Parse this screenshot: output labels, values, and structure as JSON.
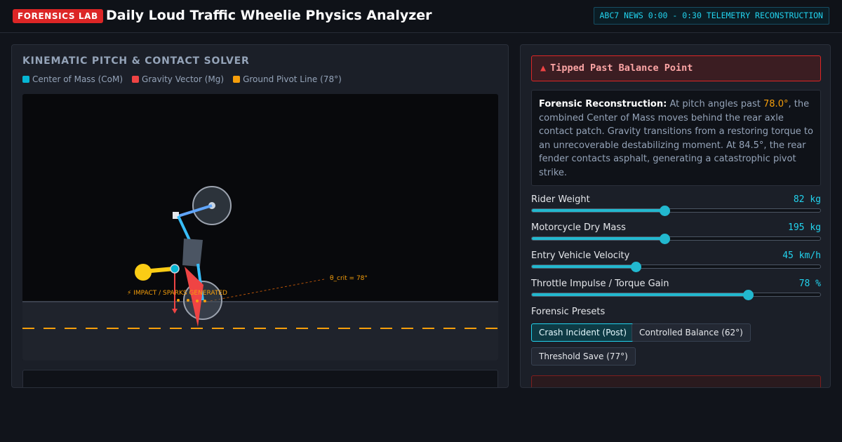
{
  "header": {
    "badge": "FORENSICS LAB",
    "title": "Daily Loud Traffic Wheelie Physics Analyzer",
    "status": "ABC7 NEWS 0:00 - 0:30 TELEMETRY RECONSTRUCTION"
  },
  "solver": {
    "title": "KINEMATIC PITCH & CONTACT SOLVER",
    "legend": [
      {
        "label": "Center of Mass (CoM)",
        "color": "#06b6d4"
      },
      {
        "label": "Gravity Vector (Mg)",
        "color": "#ef4444"
      },
      {
        "label": "Ground Pivot Line (78°)",
        "color": "#f59e0b"
      }
    ],
    "annotations": {
      "threshold": "θ_crit = 78°",
      "impact": "⚡ IMPACT / SPARKS GENERATED"
    }
  },
  "status_panel": {
    "alert_icon": "siren-icon",
    "alert": "Tipped Past Balance Point",
    "recon_title": "Forensic Reconstruction:",
    "recon_pre": "At pitch angles past",
    "recon_angle": "78.0°",
    "recon_post": ", the combined Center of Mass moves behind the rear axle contact patch. Gravity transitions from a restoring torque to an unrecoverable destabilizing moment. At 84.5°, the rear fender contacts asphalt, generating a catastrophic pivot strike."
  },
  "controls": [
    {
      "label": "Rider Weight",
      "value": "82 kg",
      "level": 0.46
    },
    {
      "label": "Motorcycle Dry Mass",
      "value": "195 kg",
      "level": 0.46
    },
    {
      "label": "Entry Vehicle Velocity",
      "value": "45 km/h",
      "level": 0.36
    },
    {
      "label": "Throttle Impulse / Torque Gain",
      "value": "78 %",
      "level": 0.75
    }
  ],
  "presets": {
    "label": "Forensic Presets",
    "items": [
      {
        "label": "Crash Incident (Post)",
        "active": true
      },
      {
        "label": "Controlled Balance (62°)",
        "active": false
      },
      {
        "label": "Threshold Save (77°)",
        "active": false
      }
    ]
  },
  "colors": {
    "accent": "#22d3ee",
    "danger": "#dc2626",
    "warning": "#f59e0b"
  }
}
